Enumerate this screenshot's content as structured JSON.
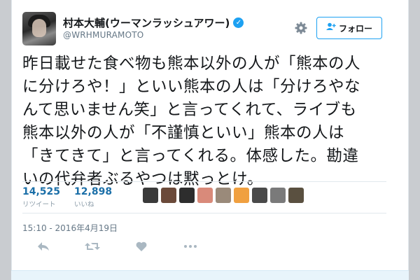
{
  "user": {
    "display_name": "村本大輔(ウーマンラッシュアワー)",
    "handle": "@WRHMURAMOTO"
  },
  "header": {
    "follow_label": "フォロー",
    "follow_icon": "person-add-icon",
    "settings_icon": "gear-icon"
  },
  "tweet": {
    "lines": [
      "昨日載せた食べ物も熊本以外の人が「熊本の人",
      "に分けろや！」といい熊本の人は「分けろやな",
      "んて思いません笑」と言ってくれて、ライブも",
      "熊本以外の人が「不謹慎といい」熊本の人は",
      "「きてきて」と言ってくれる。体感した。勘違",
      "いの代弁者ぶるやつは黙っとけ。"
    ]
  },
  "stats": {
    "retweets": {
      "count": "14,525",
      "label": "リツイート"
    },
    "likes": {
      "count": "12,898",
      "label": "いいね"
    }
  },
  "likers": {
    "count": 9,
    "colors": [
      "#3a3a3a",
      "#6b4a3a",
      "#2d2d2d",
      "#d98a7a",
      "#9a8a7a",
      "#f0a040",
      "#4a4a4a",
      "#7a7a7a",
      "#5a5040"
    ]
  },
  "meta": {
    "timestamp": "15:10 - 2016年4月19日"
  },
  "actions": [
    "reply-icon",
    "retweet-icon",
    "like-icon",
    "more-icon"
  ],
  "colors": {
    "accent": "#1da1f2",
    "stat_number": "#1b6fa8",
    "text": "#14171a",
    "muted": "#657786"
  }
}
